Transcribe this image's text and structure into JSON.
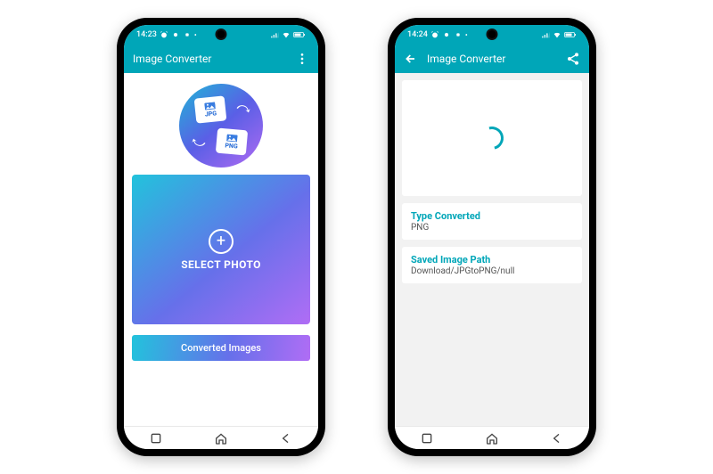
{
  "colors": {
    "teal": "#00a6b8"
  },
  "phoneA": {
    "status": {
      "time": "14:23"
    },
    "appbar": {
      "title": "Image Converter"
    },
    "logo": {
      "topFormat": "JPG",
      "bottomFormat": "PNG"
    },
    "select": {
      "label": "SELECT PHOTO"
    },
    "convertedBar": {
      "label": "Converted Images"
    }
  },
  "phoneB": {
    "status": {
      "time": "14:24"
    },
    "appbar": {
      "title": "Image Converter"
    },
    "typeCard": {
      "title": "Type Converted",
      "value": "PNG"
    },
    "pathCard": {
      "title": "Saved Image Path",
      "value": "Download/JPGtoPNG/null"
    }
  }
}
